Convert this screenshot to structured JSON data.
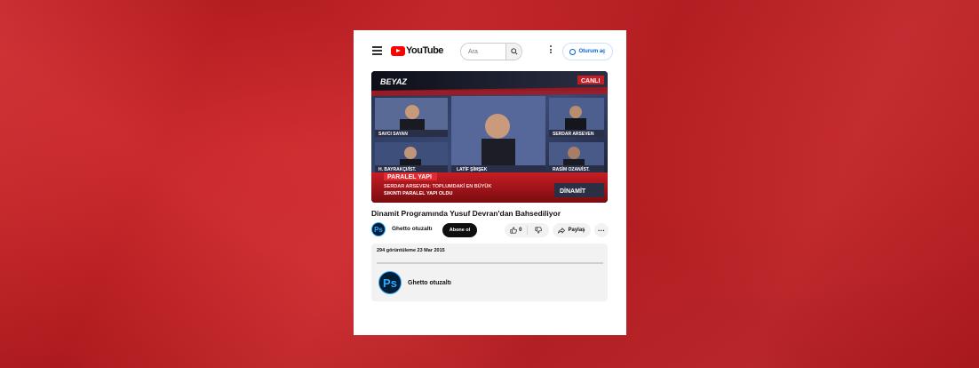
{
  "header": {
    "logo_text": "YouTube",
    "search_placeholder": "Ara",
    "signin_label": "Oturum aç"
  },
  "video": {
    "title": "Dinamit Programında Yusuf Devran'dan Bahsediliyor",
    "overlay": {
      "channel_logo": "BEYAZ",
      "live_badge": "CANLI",
      "guest_names": [
        "SAVCI SAYAN",
        "SERDAR ARSEVEN",
        "H. BAYRAKÇI/İST.",
        "LATİF ŞİMŞEK",
        "RASİM OZAN/İST."
      ],
      "banner_title": "PARALEL YAPI",
      "ticker_line1": "SERDAR ARSEVEN: TOPLUMDAKİ EN BÜYÜK",
      "ticker_line2": "SIKINTI PARALEL YAPI OLDU",
      "program_logo": "DİNAMİT"
    }
  },
  "owner": {
    "avatar_text": "Ps",
    "channel_name": "Ghetto otuzaltı",
    "subscribe_label": "Abone ol"
  },
  "actions": {
    "like_count": "0",
    "share_label": "Paylaş",
    "more_label": "···"
  },
  "description": {
    "meta": "294 görüntüleme  23 Mar 2015",
    "channel_avatar_text": "Ps",
    "channel_name": "Ghetto otuzaltı"
  },
  "colors": {
    "background": "#c91f23",
    "youtube_red": "#ff0000",
    "link_blue": "#065fd4",
    "ps_blue": "#31a8ff",
    "ps_dark": "#001e36"
  },
  "icons": [
    "menu-icon",
    "youtube-play-icon",
    "search-icon",
    "kebab-icon",
    "user-circle-icon",
    "thumbs-up-icon",
    "thumbs-down-icon",
    "share-arrow-icon"
  ]
}
